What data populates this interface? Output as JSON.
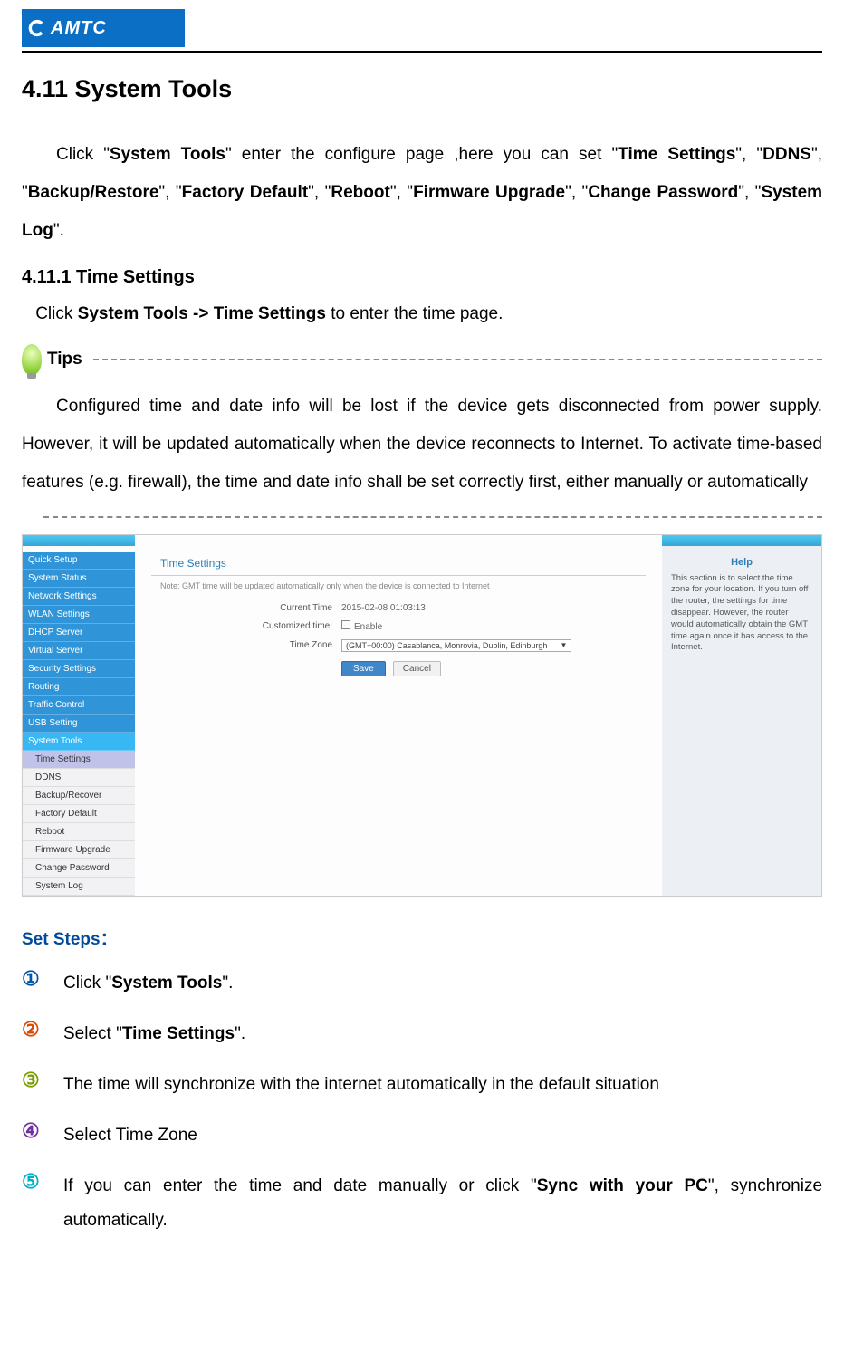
{
  "header": {
    "logo_text": "AMTC"
  },
  "section": {
    "title": "4.11 System Tools",
    "intro_pre": "Click \"",
    "intro_b1": "System Tools",
    "intro_mid1": "\" enter the configure page ,here you can set \"",
    "intro_b2": "Time Settings",
    "intro_mid2": "\", \"",
    "intro_b3": "DDNS",
    "intro_mid3": "\", \"",
    "intro_b4": "Backup/Restore",
    "intro_mid4": "\", \"",
    "intro_b5": "Factory Default",
    "intro_mid5": "\", \"",
    "intro_b6": "Reboot",
    "intro_mid6": "\", \"",
    "intro_b7": "Firmware Upgrade",
    "intro_mid7": "\", \"",
    "intro_b8": "Change Password",
    "intro_mid8": "\", \"",
    "intro_b9": "System Log",
    "intro_end": "\"."
  },
  "sub": {
    "title": "4.11.1 Time Settings",
    "nav_pre": "Click ",
    "nav_bold": "System Tools -> Time Settings",
    "nav_post": " to enter the time page."
  },
  "tips": {
    "label": "Tips",
    "body": "Configured time and date info will be lost if the device gets disconnected from power supply. However, it will be updated automatically when the device reconnects to Internet. To activate time-based features (e.g. firewall), the time and date info shall be set correctly first, either manually or automatically"
  },
  "screenshot": {
    "title": "Time Settings",
    "note": "Note: GMT time will be updated automatically only when the device is connected to Internet",
    "labels": {
      "current_time": "Current Time",
      "customized": "Customized time:",
      "enable": "Enable",
      "time_zone": "Time Zone"
    },
    "current_time_value": "2015-02-08 01:03:13",
    "tz_value": "(GMT+00:00) Casablanca, Monrovia, Dublin, Edinburgh",
    "save": "Save",
    "cancel": "Cancel",
    "help_title": "Help",
    "help_body": "This section is to select the time zone for your location. If you turn off the router, the settings for time disappear. However, the router would automatically obtain the GMT time again once it has access to the Internet.",
    "sidebar": {
      "items": [
        "Quick Setup",
        "System Status",
        "Network Settings",
        "WLAN Settings",
        "DHCP Server",
        "Virtual Server",
        "Security Settings",
        "Routing",
        "Traffic Control",
        "USB Setting",
        "System Tools"
      ],
      "subs": [
        "Time Settings",
        "DDNS",
        "Backup/Recover",
        "Factory Default",
        "Reboot",
        "Firmware Upgrade",
        "Change Password",
        "System Log"
      ]
    }
  },
  "steps": {
    "title": "Set Steps：",
    "s1_pre": "Click \"",
    "s1_b": "System Tools",
    "s1_post": "\".",
    "s2_pre": "Select \"",
    "s2_b": "Time Settings",
    "s2_post": "\".",
    "s3": "The time will synchronize with the internet   automatically in the default situation",
    "s4": "Select Time Zone",
    "s5_pre": "If you can enter the time and date manually or click \"",
    "s5_b": "Sync with your PC",
    "s5_post": "\", synchronize automatically."
  },
  "nums": {
    "n1": "①",
    "n2": "②",
    "n3": "③",
    "n4": "④",
    "n5": "⑤"
  }
}
